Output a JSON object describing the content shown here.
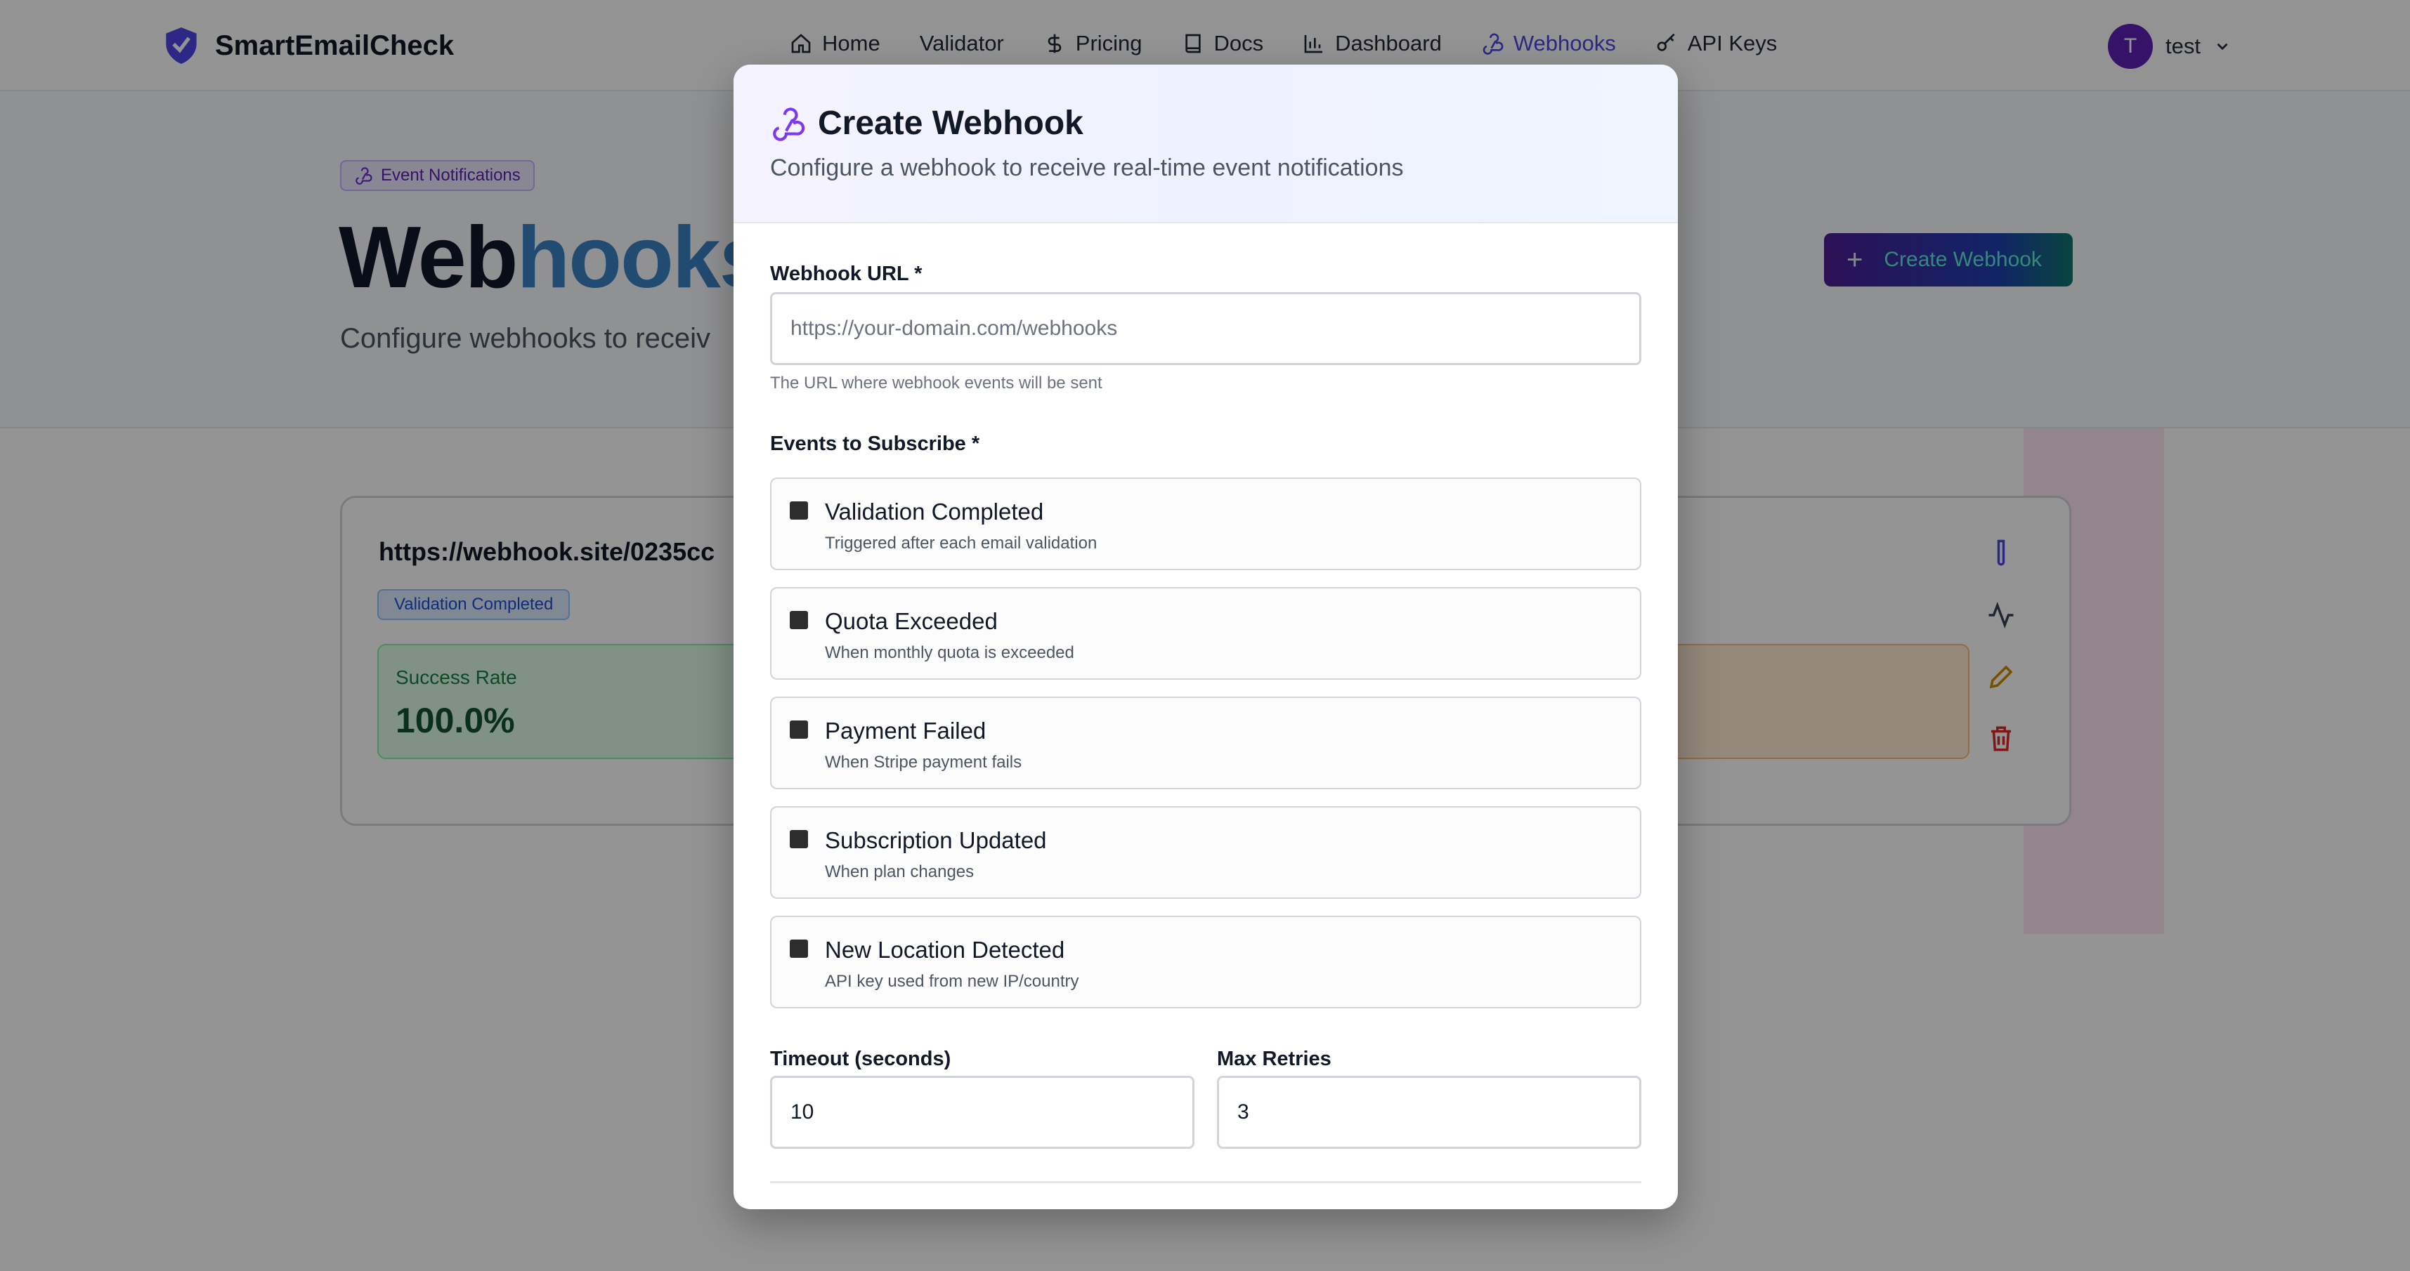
{
  "app": {
    "brand": "SmartEmailCheck",
    "accent": "#4f46e5"
  },
  "nav": {
    "items": [
      {
        "label": "Home",
        "icon": "home-icon"
      },
      {
        "label": "Validator",
        "icon": ""
      },
      {
        "label": "Pricing",
        "icon": "dollar-icon"
      },
      {
        "label": "Docs",
        "icon": "book-icon"
      },
      {
        "label": "Dashboard",
        "icon": "bar-chart-icon"
      },
      {
        "label": "Webhooks",
        "icon": "webhook-icon",
        "active": true
      },
      {
        "label": "API Keys",
        "icon": "key-icon"
      }
    ]
  },
  "user": {
    "initial": "T",
    "name": "test"
  },
  "page": {
    "badge": "Event Notifications",
    "title_part1": "Web",
    "title_part2": "hooks",
    "subtitle": "Configure webhooks to receiv",
    "create_button": "Create Webhook"
  },
  "webhook_card": {
    "url": "https://webhook.site/0235cc",
    "event_tag": "Validation Completed",
    "success_rate_label": "Success Rate",
    "success_rate_value": "100.0%"
  },
  "modal": {
    "title": "Create Webhook",
    "subtitle": "Configure a webhook to receive real-time event notifications",
    "url_label": "Webhook URL *",
    "url_placeholder": "https://your-domain.com/webhooks",
    "url_value": "",
    "url_hint": "The URL where webhook events will be sent",
    "events_label": "Events to Subscribe *",
    "events": [
      {
        "name": "Validation Completed",
        "description": "Triggered after each email validation",
        "checked": false
      },
      {
        "name": "Quota Exceeded",
        "description": "When monthly quota is exceeded",
        "checked": false
      },
      {
        "name": "Payment Failed",
        "description": "When Stripe payment fails",
        "checked": false
      },
      {
        "name": "Subscription Updated",
        "description": "When plan changes",
        "checked": false
      },
      {
        "name": "New Location Detected",
        "description": "API key used from new IP/country",
        "checked": false
      }
    ],
    "timeout_label": "Timeout (seconds)",
    "timeout_value": "10",
    "retries_label": "Max Retries",
    "retries_value": "3"
  }
}
